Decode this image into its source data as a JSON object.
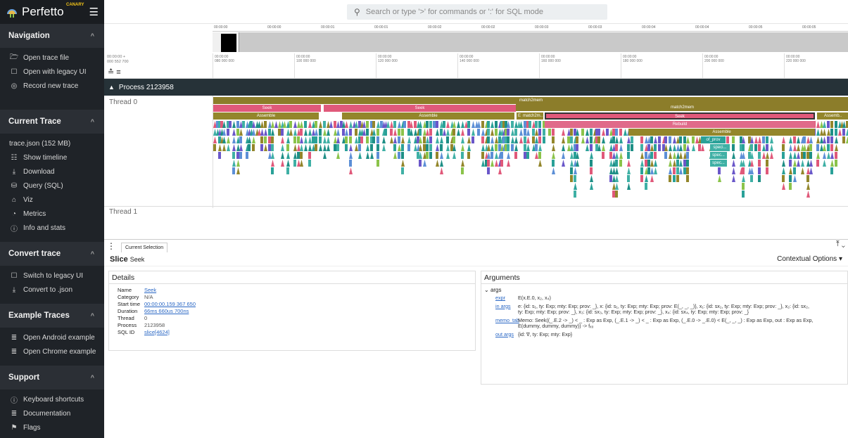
{
  "brand": {
    "name": "Perfetto",
    "badge": "CANARY"
  },
  "search": {
    "placeholder": "Search or type '>' for commands or ':' for SQL mode"
  },
  "sidebar": {
    "navigation": {
      "title": "Navigation",
      "items": [
        {
          "icon": "folder-open-icon",
          "glyph": "🗁",
          "label": "Open trace file"
        },
        {
          "icon": "open-legacy-icon",
          "glyph": "☐",
          "label": "Open with legacy UI"
        },
        {
          "icon": "record-icon",
          "glyph": "◎",
          "label": "Record new trace"
        }
      ]
    },
    "current_trace": {
      "title": "Current Trace",
      "file": "trace.json (152 MB)",
      "items": [
        {
          "icon": "timeline-icon",
          "glyph": "☷",
          "label": "Show timeline"
        },
        {
          "icon": "download-icon",
          "glyph": "⤓",
          "label": "Download"
        },
        {
          "icon": "database-icon",
          "glyph": "⛁",
          "label": "Query (SQL)"
        },
        {
          "icon": "viz-icon",
          "glyph": "⌂",
          "label": "Viz"
        },
        {
          "icon": "speed-icon",
          "glyph": "◔",
          "label": "Metrics"
        },
        {
          "icon": "info-icon",
          "glyph": "ⓘ",
          "label": "Info and stats"
        }
      ]
    },
    "convert": {
      "title": "Convert trace",
      "items": [
        {
          "icon": "legacy-ui-icon",
          "glyph": "☐",
          "label": "Switch to legacy UI"
        },
        {
          "icon": "convert-icon",
          "glyph": "⤓",
          "label": "Convert to .json"
        }
      ]
    },
    "examples": {
      "title": "Example Traces",
      "items": [
        {
          "icon": "document-icon",
          "glyph": "≣",
          "label": "Open Android example"
        },
        {
          "icon": "document-icon",
          "glyph": "≣",
          "label": "Open Chrome example"
        }
      ]
    },
    "support": {
      "title": "Support",
      "items": [
        {
          "icon": "help-icon",
          "glyph": "ⓘ",
          "label": "Keyboard shortcuts"
        },
        {
          "icon": "documentation-icon",
          "glyph": "≣",
          "label": "Documentation"
        },
        {
          "icon": "flag-icon",
          "glyph": "⚑",
          "label": "Flags"
        },
        {
          "icon": "bug-icon",
          "glyph": "⚙",
          "label": "Report a bug"
        }
      ]
    }
  },
  "overview": {
    "ticks": [
      "00:00:00",
      "00:00:00",
      "00:00:01",
      "00:00:01",
      "00:00:02",
      "00:00:02",
      "00:00:03",
      "00:00:03",
      "00:00:04",
      "00:00:04",
      "00:00:05",
      "00:00:05"
    ]
  },
  "timeaxis": {
    "offset": "00:00:00 +",
    "offset_ns": "000 552 700",
    "ticks": [
      {
        "t": "00:00:00",
        "ns": "080 000 000"
      },
      {
        "t": "00:00:00",
        "ns": "100 000 000"
      },
      {
        "t": "00:00:00",
        "ns": "120 000 000"
      },
      {
        "t": "00:00:00",
        "ns": "140 000 000"
      },
      {
        "t": "00:00:00",
        "ns": "160 000 000"
      },
      {
        "t": "00:00:00",
        "ns": "180 000 000"
      },
      {
        "t": "00:00:00",
        "ns": "200 000 000"
      },
      {
        "t": "00:00:00",
        "ns": "220 000 000"
      }
    ]
  },
  "process": {
    "title": "Process 2123958"
  },
  "threads": [
    "Thread 0",
    "Thread 1"
  ],
  "slices": {
    "top": "match2mem",
    "top2": "match2mem",
    "seek1": "Seek",
    "seek2": "Seek",
    "seek3": "Seek",
    "assemble1": "Assemble",
    "assemble2": "Assemble",
    "assemble3": "Assemble",
    "assemble4": "Assemb..",
    "rebuild": "Rebuild",
    "e": "E",
    "match2m": "match2m..",
    "ofprov": "of_prov",
    "speci": "speci...",
    "spec1": "spec...",
    "spec2": "spec..."
  },
  "colors": {
    "sidebar_bg": "#1f2328",
    "process_bar": "#263238",
    "olive": "#93862b",
    "pink": "#e0597a",
    "teal": "#2aa198",
    "link": "#2866c4"
  },
  "panel": {
    "tab": "Current Selection",
    "title_kind": "Slice",
    "title_name": "Seek",
    "contextual": "Contextual Options",
    "details_title": "Details",
    "details": [
      {
        "k": "Name",
        "v": "Seek",
        "link": true
      },
      {
        "k": "Category",
        "v": "N/A",
        "link": false
      },
      {
        "k": "Start time",
        "v": "00:00:00.159 367 650",
        "link": true
      },
      {
        "k": "Duration",
        "v": "66ms 660us 700ns",
        "link": true
      },
      {
        "k": "Thread",
        "v": "0",
        "link": false
      },
      {
        "k": "Process",
        "v": "2123958",
        "link": false
      },
      {
        "k": "SQL ID",
        "v": "slice[4624]",
        "link": true
      }
    ],
    "arguments_title": "Arguments",
    "args_root": "args",
    "args": [
      {
        "k": "expr",
        "v": "E(x.E.0, x₂, x₄)"
      },
      {
        "k": "in args",
        "v": "e: {id: s₁, ty: Exp; mty: Exp; prov: _}, x: {id: s₁, ty: Exp; mty: Exp; prov: E(_, _, _)}, x₁: {id: sx₁, ty: Exp; mty: Exp; prov: _}, x₂: {id: sx₂, ty: Exp; mty: Exp; prov: _}, x₃: {id: sx₃, ty: Exp; mty: Exp; prov: _}, x₄: {id: sx₄, ty: Exp; mty: Exp; prov: _}"
      },
      {
        "k": "memo_tab",
        "v": "Memo: Seek((_.E.2 -> _) < _ : Exp as Exp, (_.E.1 -> _) < _ : Exp as Exp, (_.E.0 -> _.E.0) < E(_, _, _) : Exp as Exp, out : Exp as Exp, E(dummy, dummy, dummy)) -> fₓ₀"
      },
      {
        "k": "out args",
        "v": "{id: ∇, ty: Exp; mty: Exp}"
      }
    ]
  }
}
